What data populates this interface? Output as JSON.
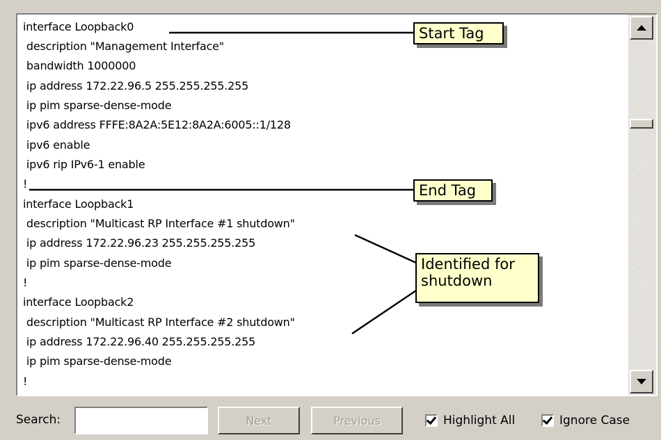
{
  "code_lines": [
    "interface Loopback0",
    " description \"Management Interface\"",
    " bandwidth 1000000",
    " ip address 172.22.96.5 255.255.255.255",
    " ip pim sparse-dense-mode",
    " ipv6 address FFFE:8A2A:5E12:8A2A:6005::1/128",
    " ipv6 enable",
    " ipv6 rip IPv6-1 enable",
    "!",
    "interface Loopback1",
    " description \"Multicast RP Interface #1 shutdown\"",
    " ip address 172.22.96.23 255.255.255.255",
    " ip pim sparse-dense-mode",
    "!",
    "interface Loopback2",
    " description \"Multicast RP Interface #2 shutdown\"",
    " ip address 172.22.96.40 255.255.255.255",
    " ip pim sparse-dense-mode",
    "!"
  ],
  "callouts": {
    "start_tag": "Start Tag",
    "end_tag": "End Tag",
    "shutdown_line1": "Identified for",
    "shutdown_line2": "shutdown"
  },
  "search": {
    "label": "Search:",
    "value": "",
    "next_label": "Next",
    "previous_label": "Previous",
    "highlight_all_label": "Highlight All",
    "highlight_all_checked": true,
    "ignore_case_label": "Ignore Case",
    "ignore_case_checked": true
  },
  "icons": {
    "scroll_up": "scroll-up-arrow-icon",
    "scroll_down": "scroll-down-arrow-icon",
    "checkmark": "checkmark-icon"
  },
  "colors": {
    "window_bg": "#d4d0c8",
    "callout_bg": "#ffffcc",
    "disabled_text": "#a09c94"
  }
}
